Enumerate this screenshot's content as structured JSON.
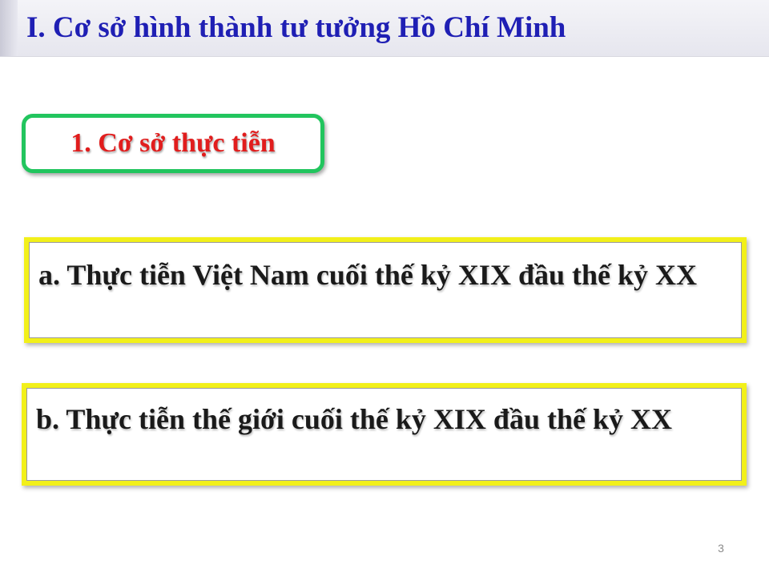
{
  "header": {
    "title": "I. Cơ sở hình thành tư tưởng Hồ Chí Minh"
  },
  "section": {
    "title": "1. Cơ sở thực tiễn"
  },
  "items": [
    {
      "text": "a. Thực tiễn Việt Nam cuối thế kỷ XIX đầu thế kỷ XX"
    },
    {
      "text": "b. Thực tiễn thế giới cuối thế kỷ XIX đầu thế kỷ XX"
    }
  ],
  "footer": {
    "page_number": "3"
  },
  "colors": {
    "title_blue": "#1f1fb4",
    "section_red": "#e11d1d",
    "section_border_green": "#22c55e",
    "item_border_yellow": "#f2f01a"
  }
}
